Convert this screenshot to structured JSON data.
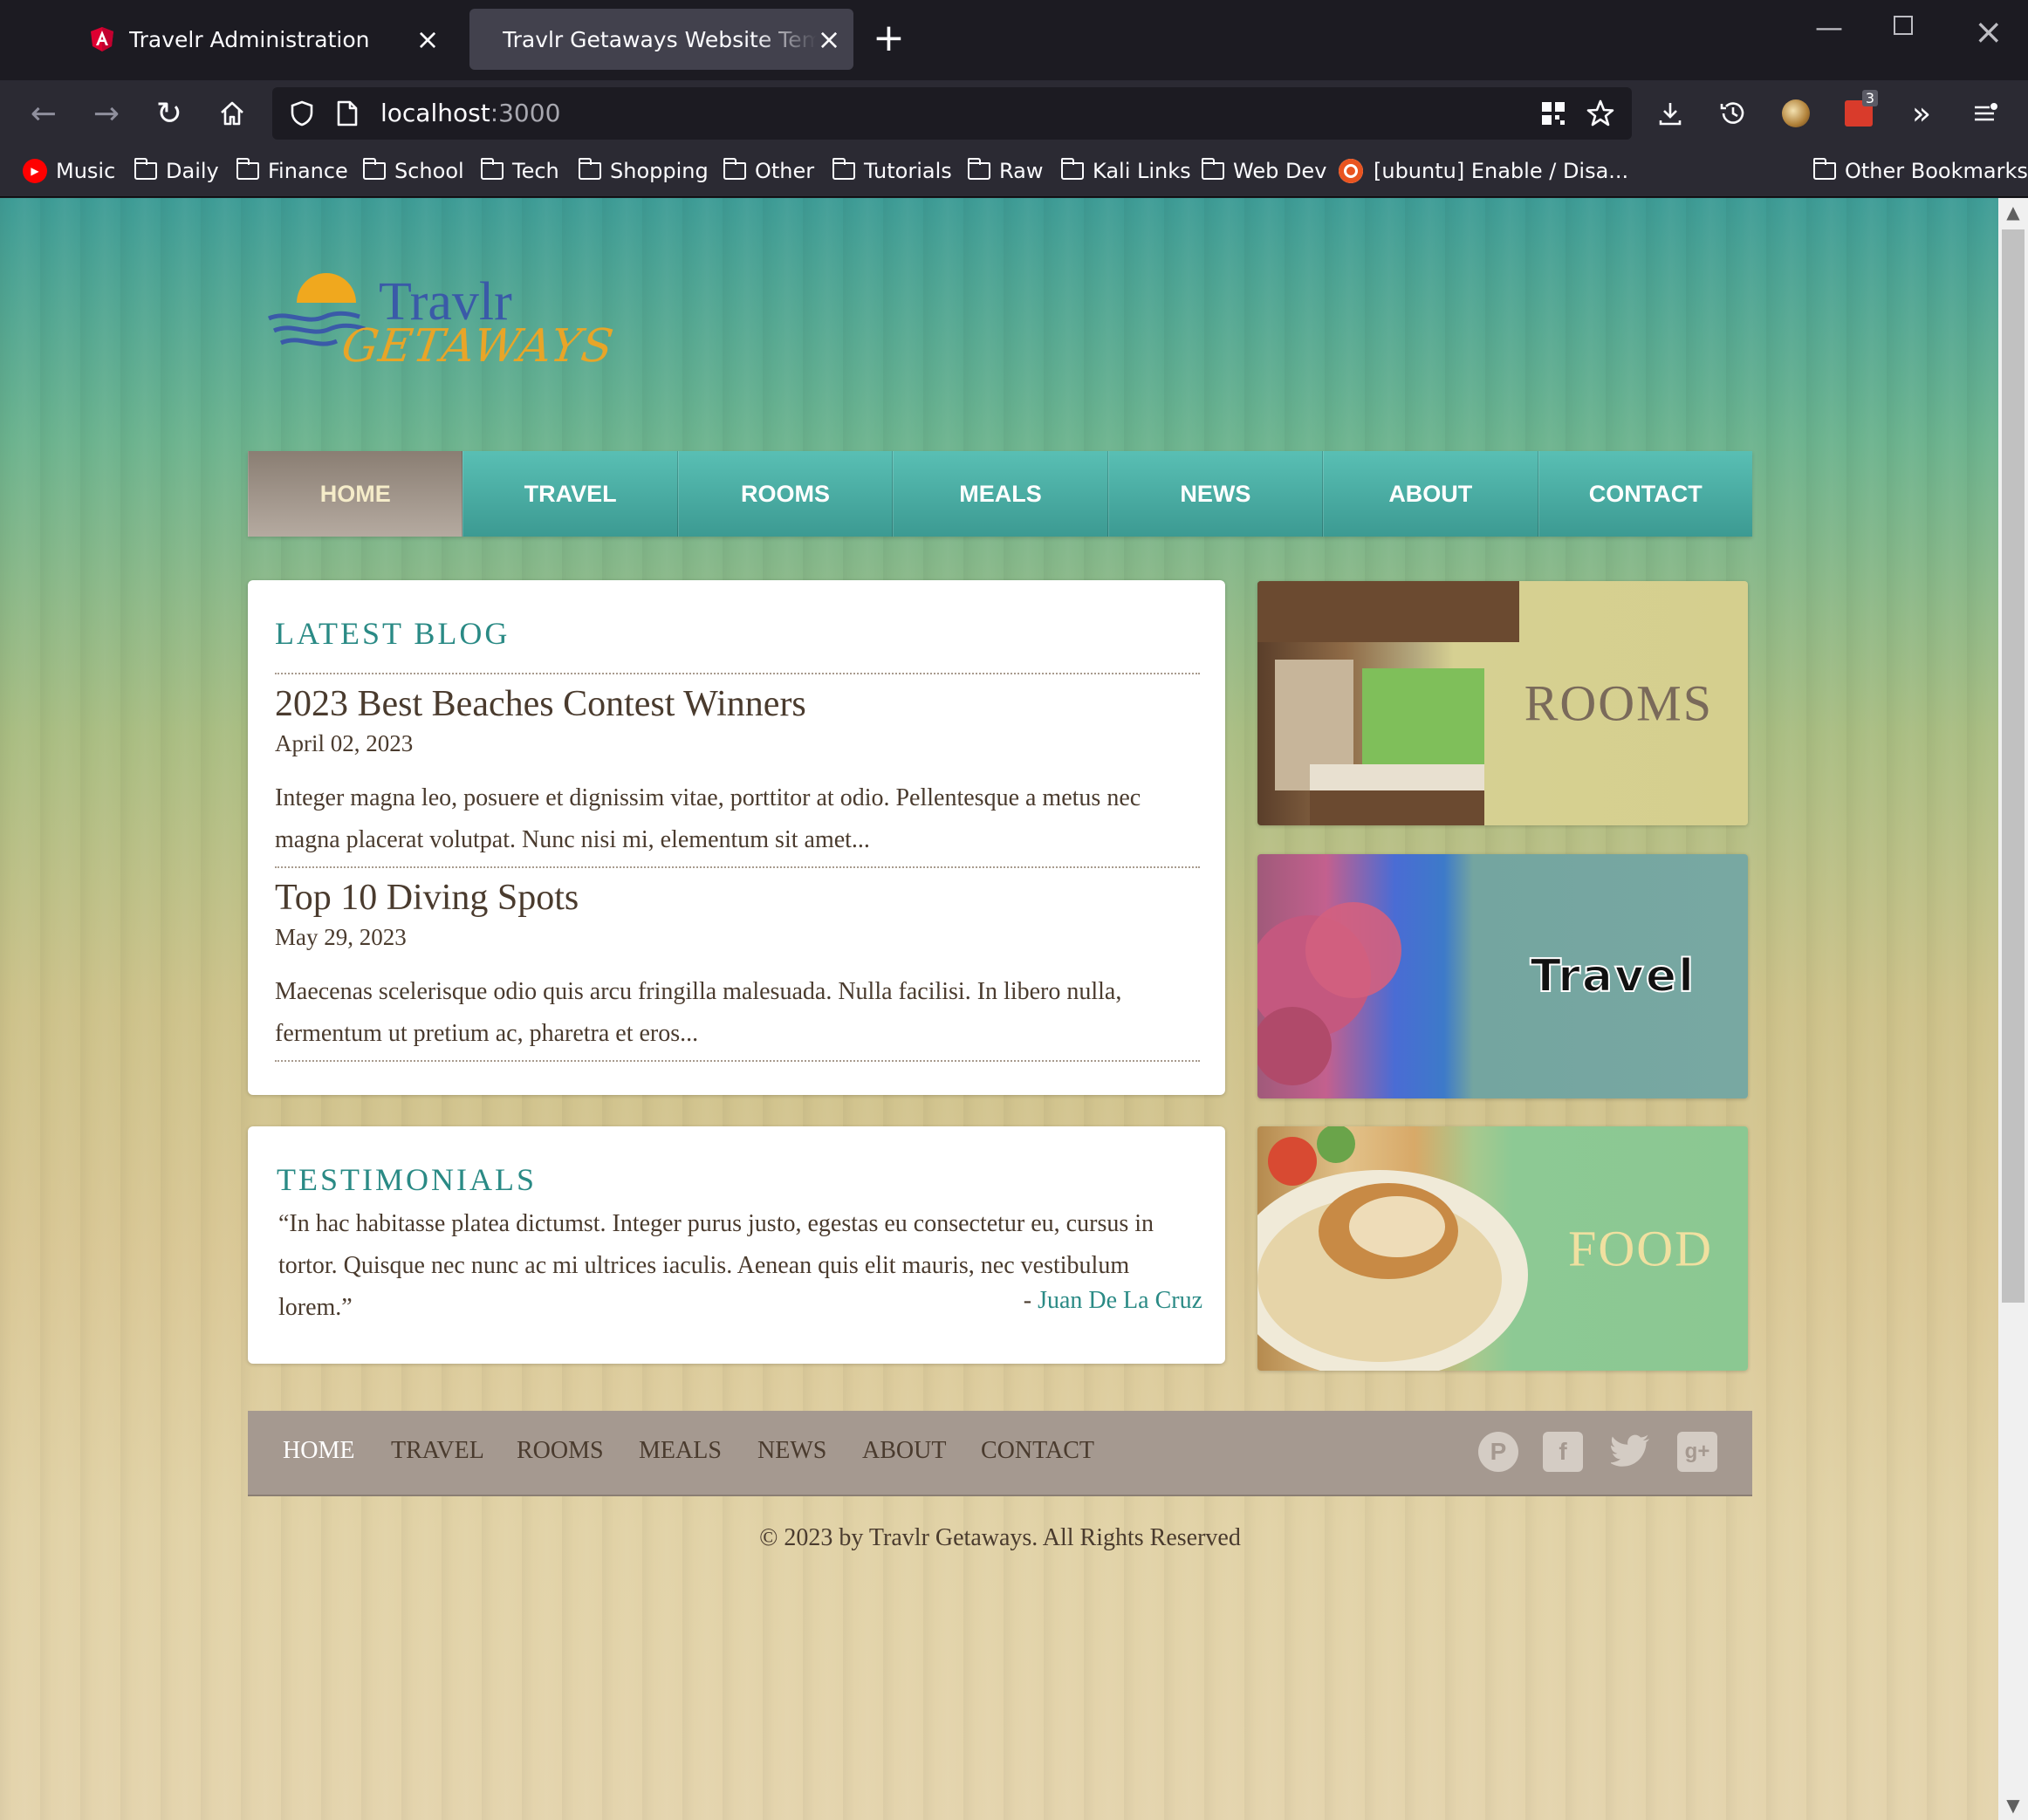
{
  "browser": {
    "tabs": [
      {
        "title": "Travelr Administration",
        "active": false
      },
      {
        "title": "Travlr Getaways Website Template",
        "active": true
      }
    ],
    "url_host": "localhost",
    "url_port": ":3000",
    "extension_badge": "3",
    "bookmarks": [
      {
        "label": "Music",
        "icon": "youtube-music-icon"
      },
      {
        "label": "Daily",
        "icon": "folder-icon"
      },
      {
        "label": "Finance",
        "icon": "folder-icon"
      },
      {
        "label": "School",
        "icon": "folder-icon"
      },
      {
        "label": "Tech",
        "icon": "folder-icon"
      },
      {
        "label": "Shopping",
        "icon": "folder-icon"
      },
      {
        "label": "Other",
        "icon": "folder-icon"
      },
      {
        "label": "Tutorials",
        "icon": "folder-icon"
      },
      {
        "label": "Raw",
        "icon": "folder-icon"
      },
      {
        "label": "Kali Links",
        "icon": "folder-icon"
      },
      {
        "label": "Web Dev",
        "icon": "folder-icon"
      },
      {
        "label": "[ubuntu] Enable / Disa...",
        "icon": "ubuntu-icon"
      }
    ],
    "other_bookmarks": "Other Bookmarks"
  },
  "site": {
    "logo_line1": "Travlr",
    "logo_line2": "GETAWAYS",
    "nav": [
      "HOME",
      "TRAVEL",
      "ROOMS",
      "MEALS",
      "NEWS",
      "ABOUT",
      "CONTACT"
    ],
    "nav_active": "HOME",
    "blog": {
      "heading": "LATEST BLOG",
      "posts": [
        {
          "title": "2023 Best Beaches Contest Winners",
          "date": "April 02, 2023",
          "body": "Integer magna leo, posuere et dignissim vitae, porttitor at odio. Pellentesque a metus nec magna placerat volutpat. Nunc nisi mi, elementum sit amet..."
        },
        {
          "title": "Top 10 Diving Spots",
          "date": "May 29, 2023",
          "body": "Maecenas scelerisque odio quis arcu fringilla malesuada. Nulla facilisi. In libero nulla, fermentum ut pretium ac, pharetra et eros..."
        }
      ]
    },
    "testimonials": {
      "heading": "TESTIMONIALS",
      "quote": "“In hac habitasse platea dictumst. Integer purus justo, egestas eu consectetur eu, cursus in tortor. Quisque nec nunc ac mi ultrices iaculis. Aenean quis elit mauris, nec vestibulum lorem.”",
      "author_prefix": "- ",
      "author": "Juan De La Cruz"
    },
    "promos": [
      "ROOMS",
      "Travel",
      "FOOD"
    ],
    "footer_nav": [
      "HOME",
      "TRAVEL",
      "ROOMS",
      "MEALS",
      "NEWS",
      "ABOUT",
      "CONTACT"
    ],
    "social": [
      "pinterest-icon",
      "facebook-icon",
      "twitter-icon",
      "google-plus-icon"
    ],
    "copyright": "© 2023 by Travlr Getaways. All Rights Reserved"
  },
  "colors": {
    "accent_teal": "#2a8a85",
    "nav_teal": "#3c9a92",
    "nav_active": "#8a7e73",
    "text_brown": "#4a3b2e",
    "footer_bar": "#a59990"
  }
}
